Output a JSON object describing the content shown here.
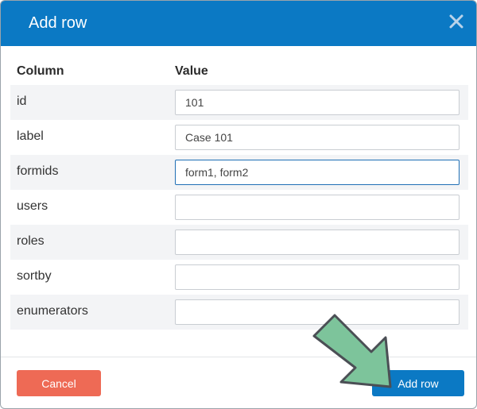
{
  "dialog": {
    "title": "Add row",
    "close_icon": "close-icon"
  },
  "table": {
    "headers": {
      "column": "Column",
      "value": "Value"
    },
    "rows": [
      {
        "column": "id",
        "value": "101"
      },
      {
        "column": "label",
        "value": "Case 101"
      },
      {
        "column": "formids",
        "value": "form1, form2"
      },
      {
        "column": "users",
        "value": ""
      },
      {
        "column": "roles",
        "value": ""
      },
      {
        "column": "sortby",
        "value": ""
      },
      {
        "column": "enumerators",
        "value": ""
      }
    ]
  },
  "footer": {
    "cancel_label": "Cancel",
    "add_label": "Add row"
  },
  "annotation": {
    "arrow_icon": "pointer-arrow-icon",
    "arrow_color": "#7dc49b"
  },
  "colors": {
    "header": "#0b79c4",
    "cancel": "#ee6a55",
    "primary": "#0b79c4"
  }
}
